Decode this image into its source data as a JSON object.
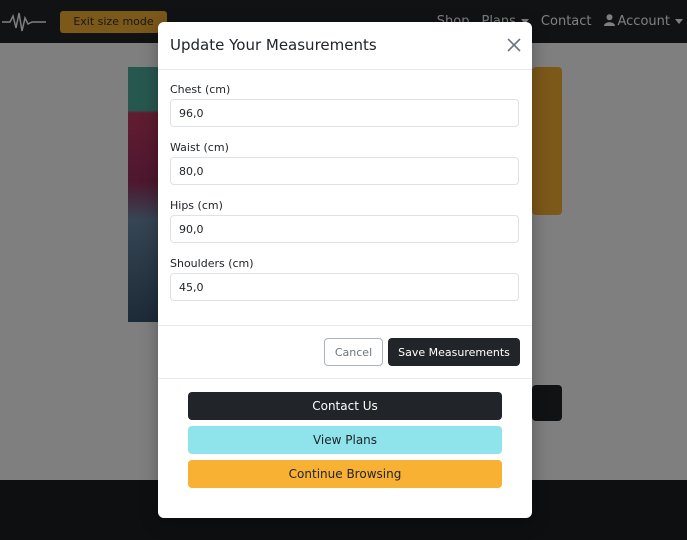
{
  "navbar": {
    "exit_size_mode": "Exit size mode",
    "links": {
      "shop": "Shop",
      "plans": "Plans",
      "contact": "Contact",
      "account": "Account"
    }
  },
  "modal": {
    "title": "Update Your Measurements",
    "fields": [
      {
        "label": "Chest (cm)",
        "value": "96,0"
      },
      {
        "label": "Waist (cm)",
        "value": "80,0"
      },
      {
        "label": "Hips (cm)",
        "value": "90,0"
      },
      {
        "label": "Shoulders (cm)",
        "value": "45,0"
      }
    ],
    "cancel_label": "Cancel",
    "save_label": "Save Measurements"
  },
  "actions": {
    "contact_label": "Contact Us",
    "plans_label": "View Plans",
    "browse_label": "Continue Browsing"
  },
  "icons": [
    "logo-waveform-icon",
    "close-icon",
    "user-icon",
    "chevron-down-icon",
    "cart-icon"
  ],
  "colors": {
    "accent": "#f8b133",
    "dark": "#212529",
    "cyan": "#8fe3ea"
  }
}
